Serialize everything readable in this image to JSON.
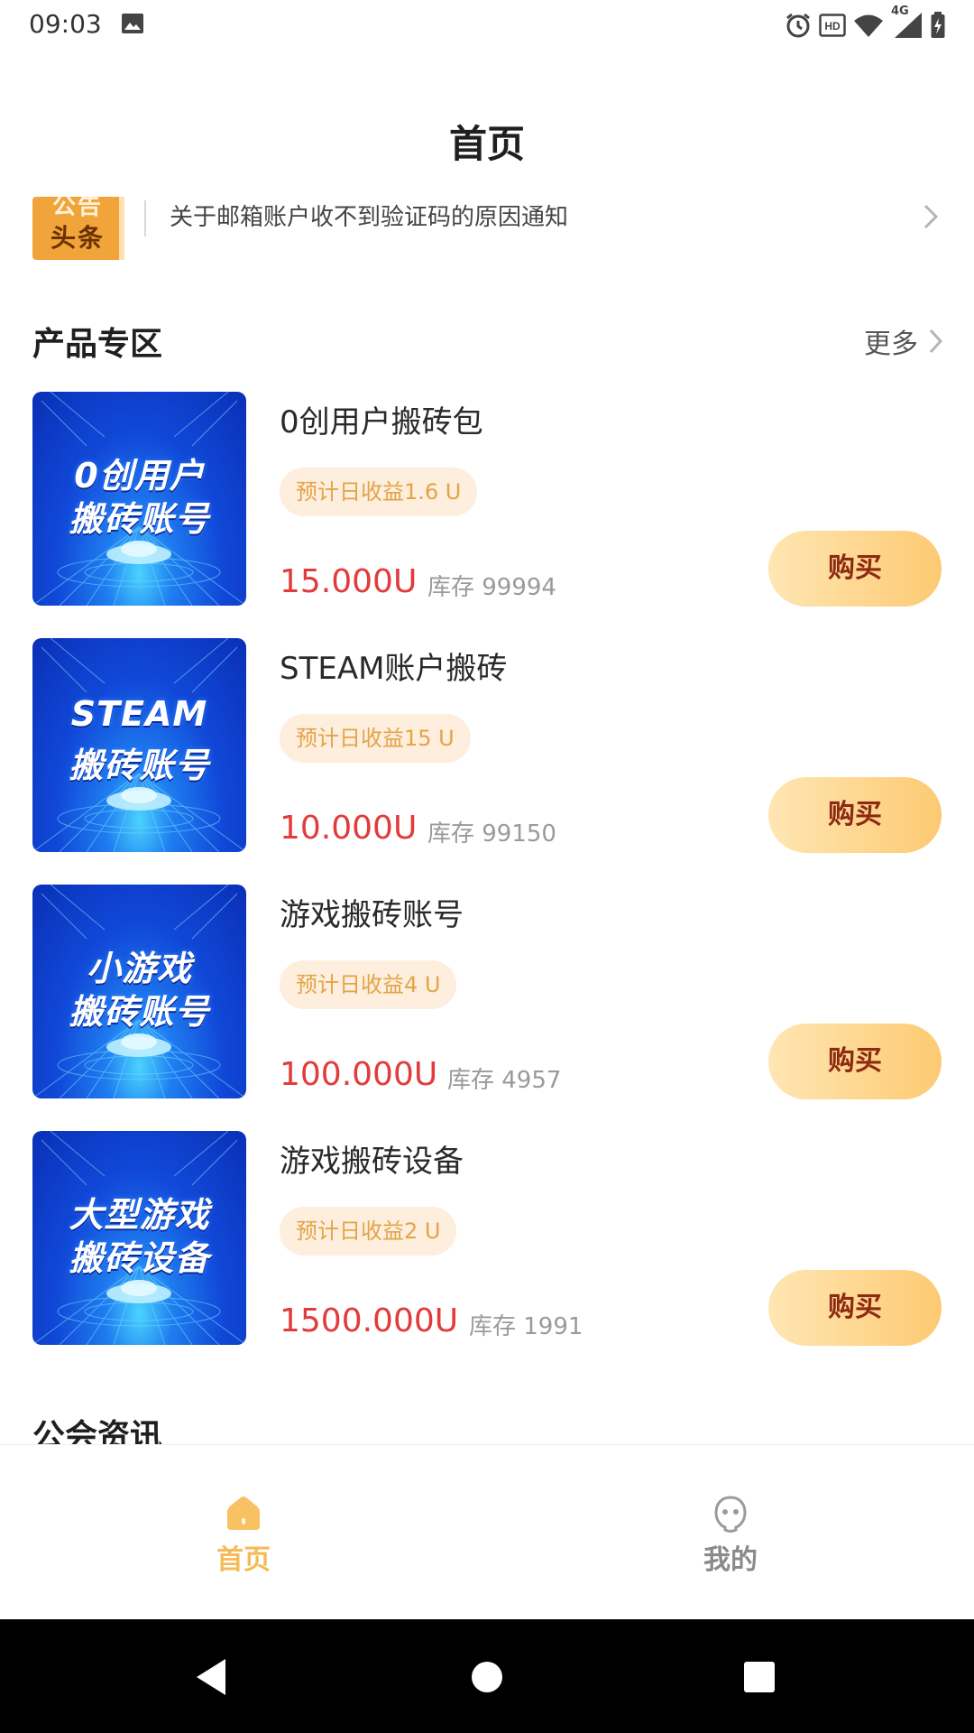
{
  "status_bar": {
    "time": "09:03",
    "network": "4G",
    "icons": [
      "gallery-icon",
      "alarm-icon",
      "hd-icon",
      "wifi-icon",
      "signal-icon",
      "battery-icon"
    ]
  },
  "header": {
    "title": "首页"
  },
  "notice": {
    "logo_top": "公告",
    "logo_main": "头条",
    "text": "关于邮箱账户收不到验证码的原因通知"
  },
  "products_section": {
    "title": "产品专区",
    "more_label": "更多",
    "buy_label": "购买",
    "stock_prefix": "库存",
    "items": [
      {
        "name": "0创用户搬砖包",
        "image_line1": "0创用户",
        "image_line2": "搬砖账号",
        "badge": "预计日收益1.6 U",
        "price": "15.000U",
        "stock": "库存 99994"
      },
      {
        "name": "STEAM账户搬砖",
        "image_line1": "STEAM",
        "image_line2": "搬砖账号",
        "badge": "预计日收益15 U",
        "price": "10.000U",
        "stock": "库存 99150"
      },
      {
        "name": "游戏搬砖账号",
        "image_line1": "小游戏",
        "image_line2": "搬砖账号",
        "badge": "预计日收益4 U",
        "price": "100.000U",
        "stock": "库存 4957"
      },
      {
        "name": "游戏搬砖设备",
        "image_line1": "大型游戏",
        "image_line2": "搬砖设备",
        "badge": "预计日收益2 U",
        "price": "1500.000U",
        "stock": "库存 1991"
      }
    ]
  },
  "news_section": {
    "title": "公会资讯"
  },
  "bottom_nav": {
    "items": [
      {
        "label": "首页",
        "icon": "home-icon",
        "active": true
      },
      {
        "label": "我的",
        "icon": "profile-icon",
        "active": false
      }
    ]
  },
  "colors": {
    "accent": "#f5bb57",
    "price": "#e23b3b",
    "badge_bg": "#fdeede",
    "badge_text": "#e4a447",
    "buy_text": "#8c2a12"
  }
}
